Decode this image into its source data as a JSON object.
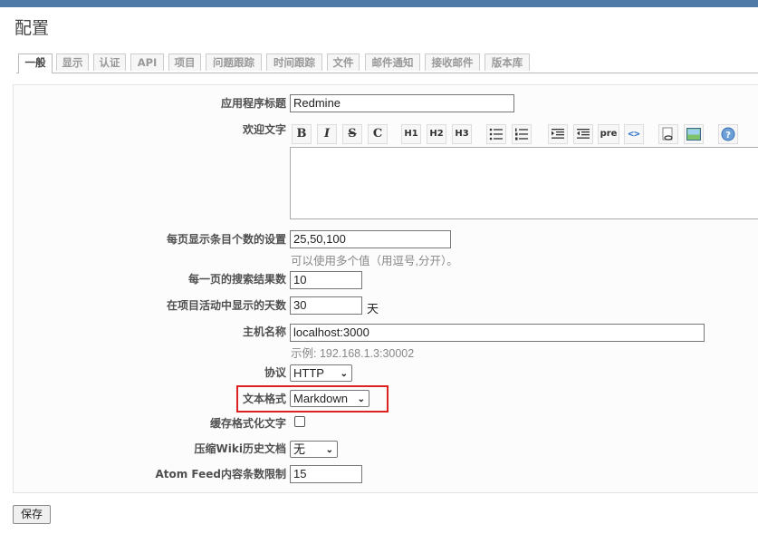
{
  "page_title": "配置",
  "tabs": [
    {
      "label": "一般"
    },
    {
      "label": "显示"
    },
    {
      "label": "认证"
    },
    {
      "label": "API"
    },
    {
      "label": "项目"
    },
    {
      "label": "问题跟踪"
    },
    {
      "label": "时间跟踪"
    },
    {
      "label": "文件"
    },
    {
      "label": "邮件通知"
    },
    {
      "label": "接收邮件"
    },
    {
      "label": "版本库"
    }
  ],
  "settings": {
    "app_title_label": "应用程序标题",
    "app_title_value": "Redmine",
    "welcome_label": "欢迎文字",
    "per_page_label": "每页显示条目个数的设置",
    "per_page_value": "25,50,100",
    "per_page_hint": "可以使用多个值（用逗号,分开）。",
    "search_results_label": "每一页的搜索结果数",
    "search_results_value": "10",
    "activity_days_label": "在项目活动中显示的天数",
    "activity_days_value": "30",
    "activity_days_unit": "天",
    "host_name_label": "主机名称",
    "host_name_value": "localhost:3000",
    "host_name_hint": "示例: 192.168.1.3:30002",
    "protocol_label": "协议",
    "protocol_value": "HTTP",
    "text_format_label": "文本格式",
    "text_format_value": "Markdown",
    "cache_label": "缓存格式化文字",
    "cache_checked": false,
    "compress_label": "压缩Wiki历史文档",
    "compress_value": "无",
    "atom_label": "Atom Feed内容条数限制",
    "atom_value": "15"
  },
  "toolbar": {
    "bold": "B",
    "italic": "I",
    "strike": "S",
    "code": "C",
    "h1": "H1",
    "h2": "H2",
    "h3": "H3",
    "pre": "pre"
  },
  "save_label": "保存",
  "colors": {
    "topbar": "#4f79a6",
    "highlight": "#dd2222"
  }
}
